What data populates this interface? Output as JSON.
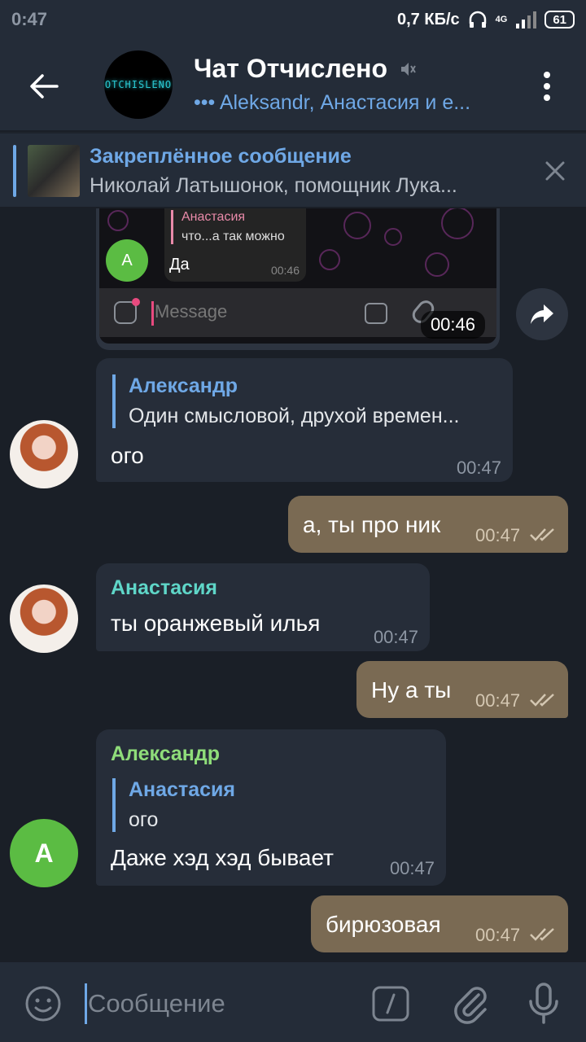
{
  "status": {
    "time": "0:47",
    "speed": "0,7 КБ/с",
    "network": "4G",
    "battery": "61"
  },
  "header": {
    "chat_avatar_text": "OTCHISLENO",
    "title": "Чат Отчислено",
    "subtitle": "••• Aleksandr, Анастасия и е..."
  },
  "pinned": {
    "title": "Закреплённое сообщение",
    "text": "Николай Латышонок, помощник Лука..."
  },
  "screenshot": {
    "reply_name": "Анастасия",
    "reply_text": "что...а так можно",
    "message": "Да",
    "msg_time": "00:46",
    "avatar_letter": "A",
    "input_placeholder": "Message",
    "time": "00:46"
  },
  "messages": [
    {
      "reply_name": "Александр",
      "reply_text": "Один смысловой, друхой времен...",
      "text": "ого",
      "time": "00:47"
    },
    {
      "text": "а, ты про ник",
      "time": "00:47"
    },
    {
      "name": "Анастасия",
      "text": "ты оранжевый илья",
      "time": "00:47"
    },
    {
      "text": "Ну а ты",
      "time": "00:47"
    },
    {
      "name": "Александр",
      "reply_name": "Анастасия",
      "reply_text": "ого",
      "text": "Даже хэд хэд бывает",
      "time": "00:47",
      "avatar_letter": "A"
    },
    {
      "text": "бирюзовая",
      "time": "00:47"
    }
  ],
  "input": {
    "placeholder": "Сообщение"
  },
  "colors": {
    "accent": "#6fa8e6",
    "name_teal": "#5fd6c8",
    "name_green": "#8fdd7a",
    "outgoing": "#7a6a53"
  }
}
